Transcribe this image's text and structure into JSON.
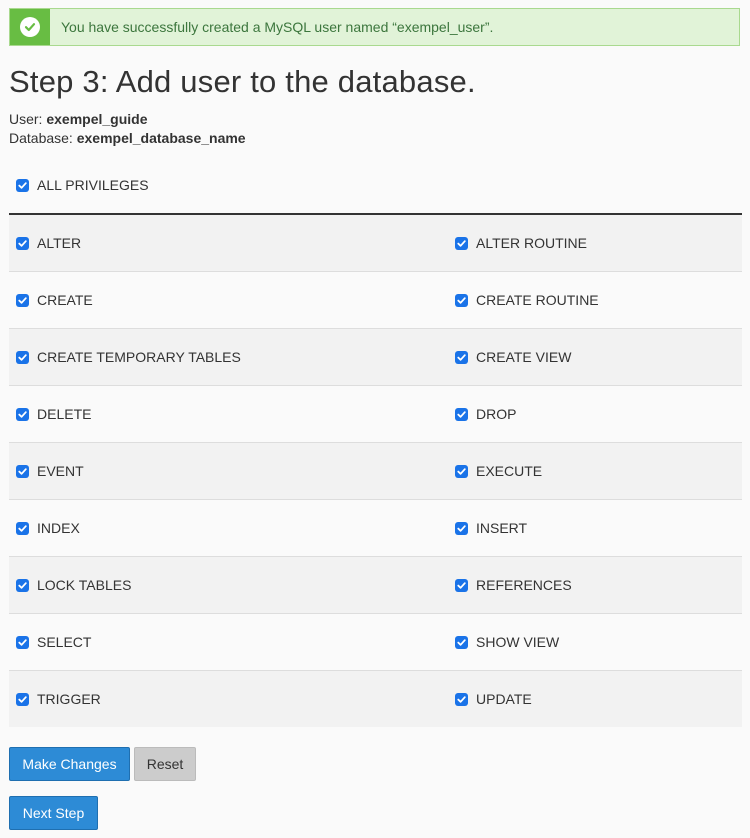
{
  "alert": {
    "icon": "check-circle-icon",
    "message": "You have successfully created a MySQL user named “exempel_user”."
  },
  "title": "Step 3: Add user to the database.",
  "meta": {
    "user_label": "User:",
    "user_value": "exempel_guide",
    "database_label": "Database:",
    "database_value": "exempel_database_name"
  },
  "all_privileges": {
    "label": "ALL PRIVILEGES",
    "checked": true
  },
  "privileges": [
    {
      "left": "ALTER",
      "right": "ALTER ROUTINE"
    },
    {
      "left": "CREATE",
      "right": "CREATE ROUTINE"
    },
    {
      "left": "CREATE TEMPORARY TABLES",
      "right": "CREATE VIEW"
    },
    {
      "left": "DELETE",
      "right": "DROP"
    },
    {
      "left": "EVENT",
      "right": "EXECUTE"
    },
    {
      "left": "INDEX",
      "right": "INSERT"
    },
    {
      "left": "LOCK TABLES",
      "right": "REFERENCES"
    },
    {
      "left": "SELECT",
      "right": "SHOW VIEW"
    },
    {
      "left": "TRIGGER",
      "right": "UPDATE"
    }
  ],
  "buttons": {
    "make_changes": "Make Changes",
    "reset": "Reset",
    "next_step": "Next Step"
  },
  "colors": {
    "checkbox": "#1a73e8",
    "alert_bg": "#e1f3d8",
    "alert_icon_bg": "#68bd43",
    "primary_button": "#2d8bd6"
  }
}
